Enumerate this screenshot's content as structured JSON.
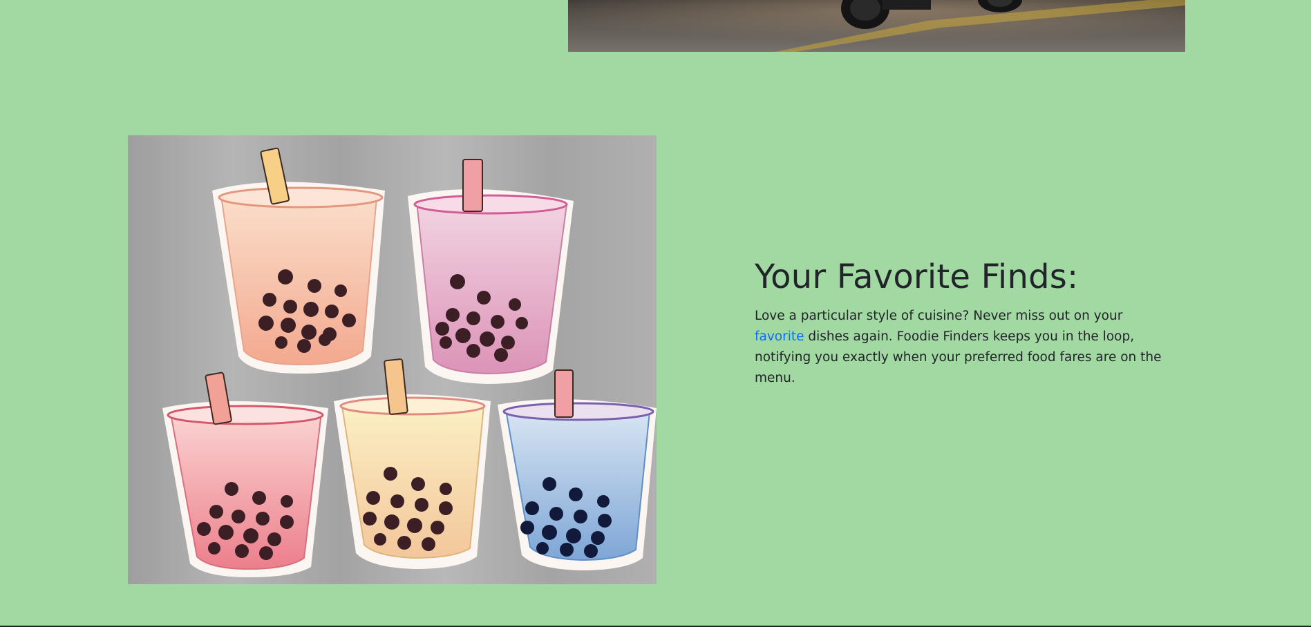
{
  "top_image": {
    "alt": "",
    "colors": {
      "road": "#5a5550",
      "line": "#c9a83a",
      "tire": "#1b1b1b"
    }
  },
  "feature": {
    "title": "Your Favorite Finds:",
    "body_before_link": "Love a particular style of cuisine? Never miss out on your ",
    "link_text": "favorite",
    "body_after_link": " dishes again. Foodie Finders keeps you in the loop, notifying you exactly when your preferred food fares are on the menu."
  },
  "boba_image": {
    "alt": "",
    "colors": {
      "background": "#a9a9aa",
      "cup_peach": "#f6b8a0",
      "cup_pink": "#e7a6c2",
      "cup_red": "#ef8f98",
      "cup_yellow": "#f6dca0",
      "cup_blue": "#8fb3d9",
      "pearls": "#3b1f25"
    }
  },
  "theme": {
    "page_background": "#a2d9a2",
    "text": "#212529",
    "link": "#0d6efd"
  }
}
